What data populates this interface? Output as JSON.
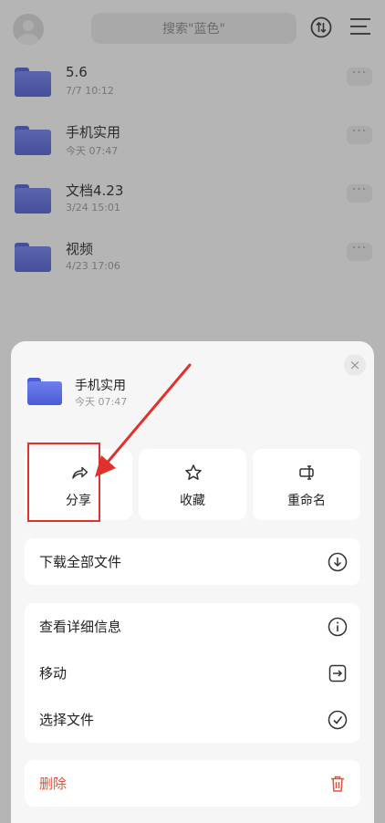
{
  "topbar": {
    "search_placeholder": "搜索\"蓝色\""
  },
  "files": [
    {
      "name": "5.6",
      "time": "7/7 10:12"
    },
    {
      "name": "手机实用",
      "time": "今天 07:47"
    },
    {
      "name": "文档4.23",
      "time": "3/24 15:01"
    },
    {
      "name": "视频",
      "time": "4/23 17:06"
    }
  ],
  "more_label": "···",
  "sheet": {
    "close_label": "×",
    "folder_name": "手机实用",
    "folder_time": "今天 07:47",
    "actions": [
      {
        "label": "分享",
        "icon": "share-icon"
      },
      {
        "label": "收藏",
        "icon": "star-icon"
      },
      {
        "label": "重命名",
        "icon": "rename-icon"
      }
    ],
    "download_all": {
      "label": "下载全部文件",
      "icon": "download-icon"
    },
    "options": [
      {
        "label": "查看详细信息",
        "icon": "info-icon"
      },
      {
        "label": "移动",
        "icon": "move-icon"
      },
      {
        "label": "选择文件",
        "icon": "check-icon"
      }
    ],
    "delete": {
      "label": "删除",
      "icon": "trash-icon"
    }
  },
  "colors": {
    "folder": "#5b6ce6",
    "danger": "#e6503a",
    "highlight": "#e0312c"
  }
}
